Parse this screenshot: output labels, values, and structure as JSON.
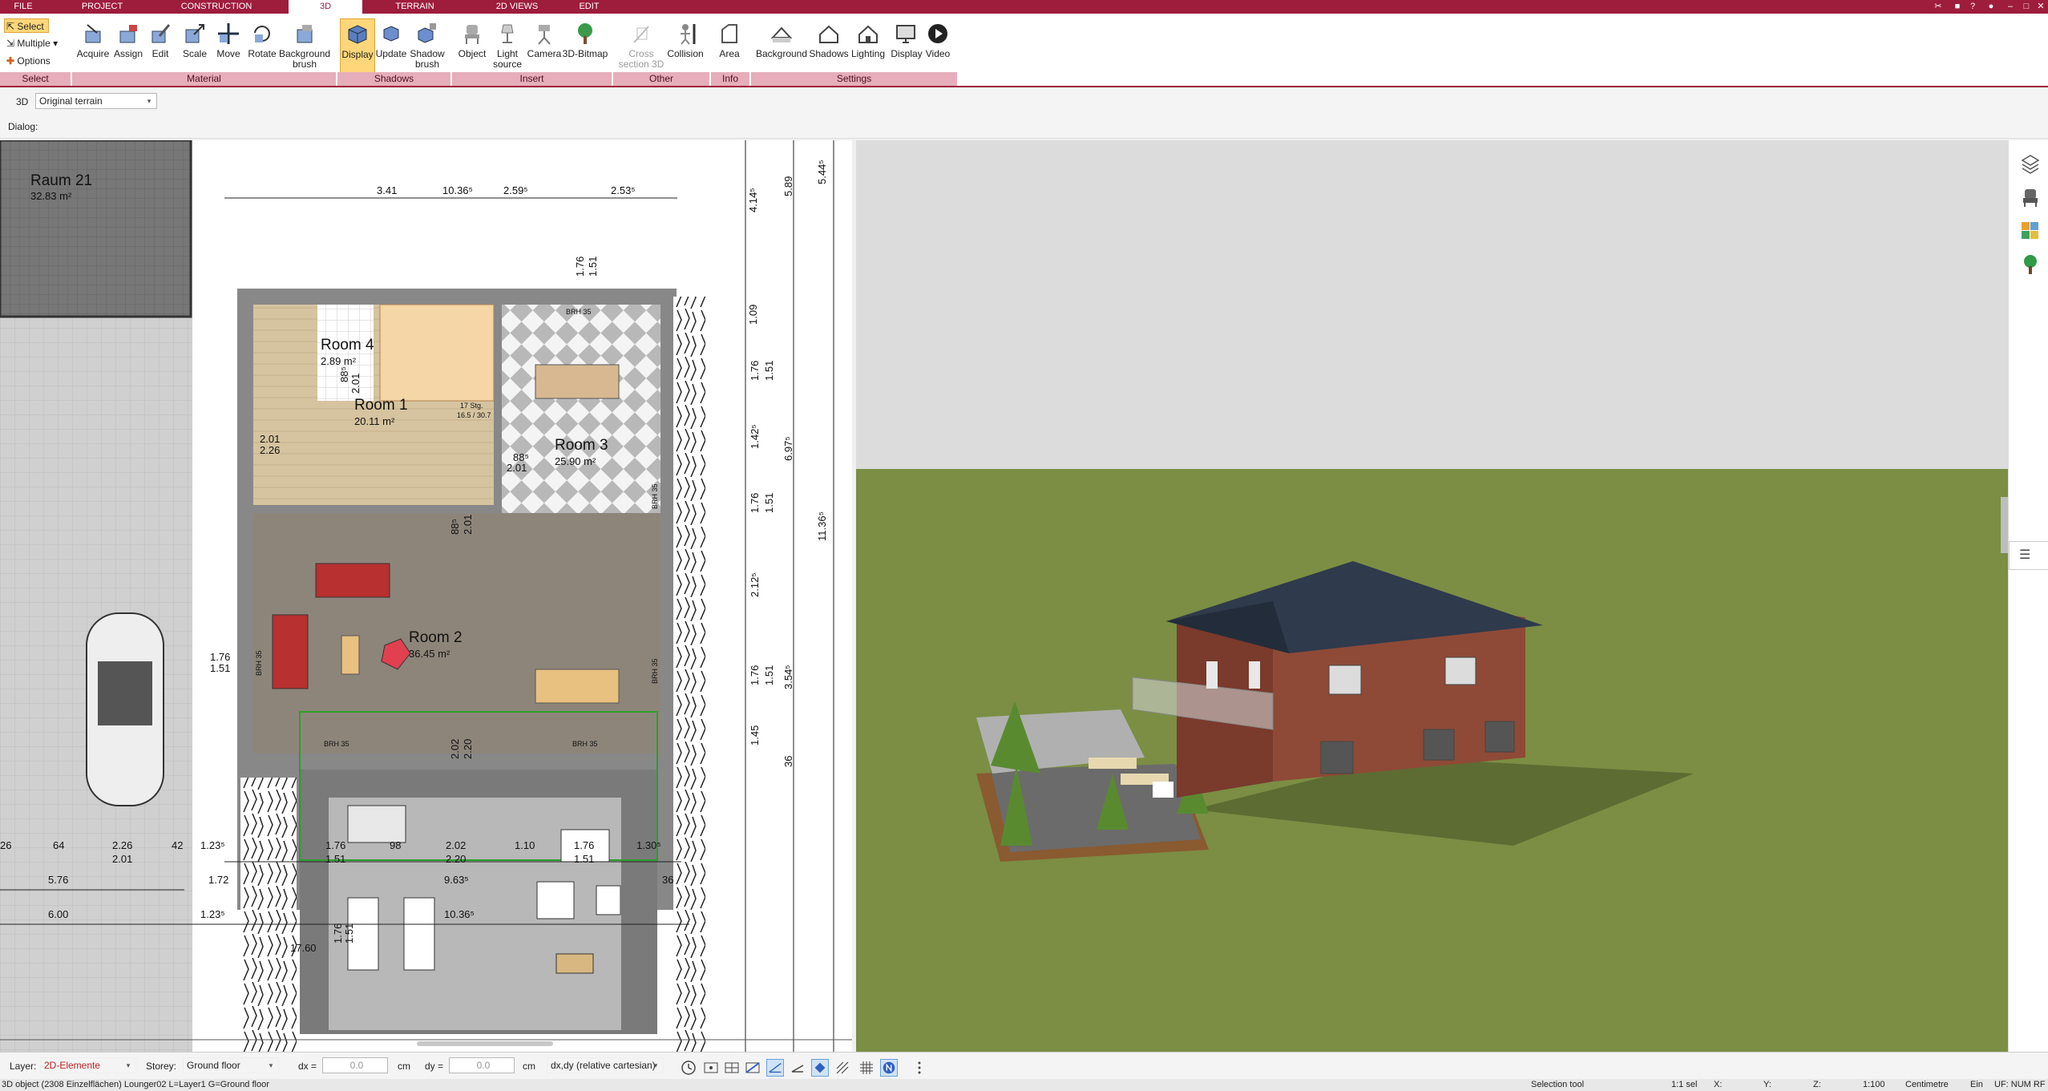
{
  "menu": {
    "tabs": [
      "FILE",
      "PROJECT",
      "CONSTRUCTION",
      "3D",
      "TERRAIN",
      "2D VIEWS",
      "EDIT"
    ],
    "active": "3D"
  },
  "ribbon": {
    "select": {
      "select": "Select",
      "multiple": "Multiple",
      "options": "Options",
      "group": "Select"
    },
    "material": {
      "acquire": "Acquire",
      "assign": "Assign",
      "edit": "Edit",
      "scale": "Scale",
      "move": "Move",
      "rotate": "Rotate",
      "background_brush": "Background brush",
      "group": "Material"
    },
    "shadows": {
      "display": "Display",
      "update": "Update",
      "shadow_brush": "Shadow brush",
      "group": "Shadows"
    },
    "insert": {
      "object": "Object",
      "light_source": "Light source",
      "camera": "Camera",
      "bitmap": "3D-Bitmap",
      "group": "Insert"
    },
    "other": {
      "cross_section": "Cross section 3D",
      "collision": "Collision",
      "group": "Other"
    },
    "info": {
      "area": "Area",
      "group": "Info"
    },
    "settings": {
      "background": "Background",
      "shadows": "Shadows",
      "lighting": "Lighting",
      "display": "Display",
      "video": "Video",
      "group": "Settings"
    }
  },
  "row3d": {
    "label": "3D",
    "terrain": "Original terrain"
  },
  "dialog": {
    "label": "Dialog:"
  },
  "plan": {
    "rooms": [
      {
        "name": "Raum 21",
        "area": "32.83 m²"
      },
      {
        "name": "Room 4",
        "area": "2.89 m²"
      },
      {
        "name": "Room 1",
        "area": "20.11 m²"
      },
      {
        "name": "Room 3",
        "area": "25.90 m²"
      },
      {
        "name": "Room 2",
        "area": "36.45 m²"
      }
    ],
    "dims_top": [
      "3.41",
      "10.36⁵",
      "2.59⁵",
      "2.53⁵"
    ],
    "dims_right": [
      "5.89",
      "5.44⁵",
      "4.14⁵",
      "1.09",
      "1.76",
      "1.51",
      "1.42⁵",
      "6.97⁵",
      "11.36⁵",
      "1.76",
      "1.51",
      "2.12⁵",
      "1.76",
      "1.51",
      "3.54⁵",
      "1.45",
      "36"
    ],
    "dims_bottom": [
      "64",
      "2.26",
      "2.01",
      "42",
      "1.23⁵",
      "5.76",
      "1.72",
      "6.00",
      "1.23⁵",
      "1.76",
      "1.51",
      "98",
      "2.02",
      "2.20",
      "1.10",
      "1.76",
      "1.51",
      "1.30⁵",
      "9.63⁵",
      "10.36⁵",
      "17.60",
      "36",
      "26"
    ],
    "misc": [
      "BRH 35",
      "BRH 35",
      "BRH 35",
      "BRH 35",
      "BRH 35",
      "BRH 35",
      "2.01",
      "2.26",
      "88⁵",
      "2.01",
      "88⁵",
      "2.01",
      "88⁵",
      "2.01",
      "1.76",
      "1.51",
      "1.76",
      "1.51",
      "2.02",
      "2.20",
      "17 Stg.",
      "16.5 / 30.7",
      "1.76",
      "1.51"
    ]
  },
  "status": {
    "layer_label": "Layer:",
    "layer_value": "2D-Elemente",
    "storey_label": "Storey:",
    "storey_value": "Ground floor",
    "dx_label": "dx =",
    "dx_value": "0.0",
    "dx_unit": "cm",
    "dy_label": "dy =",
    "dy_value": "0.0",
    "dy_unit": "cm",
    "coord_mode": "dx,dy (relative cartesian)"
  },
  "info": {
    "object": "3D object (2308 Einzelflächen) Lounger02 L=Layer1 G=Ground floor",
    "tool": "Selection tool",
    "sel": "1:1 sel",
    "x": "X:",
    "y": "Y:",
    "z": "Z:",
    "scale": "1:100",
    "unit": "Centimetre",
    "ein": "Ein",
    "uf": "UF: NUM RF"
  },
  "colors": {
    "brand": "#9e1c3c",
    "group_bg": "#e6aeba",
    "active_btn": "#ffd77a",
    "grass": "#7a8f45",
    "sky": "#dcdcdc"
  }
}
